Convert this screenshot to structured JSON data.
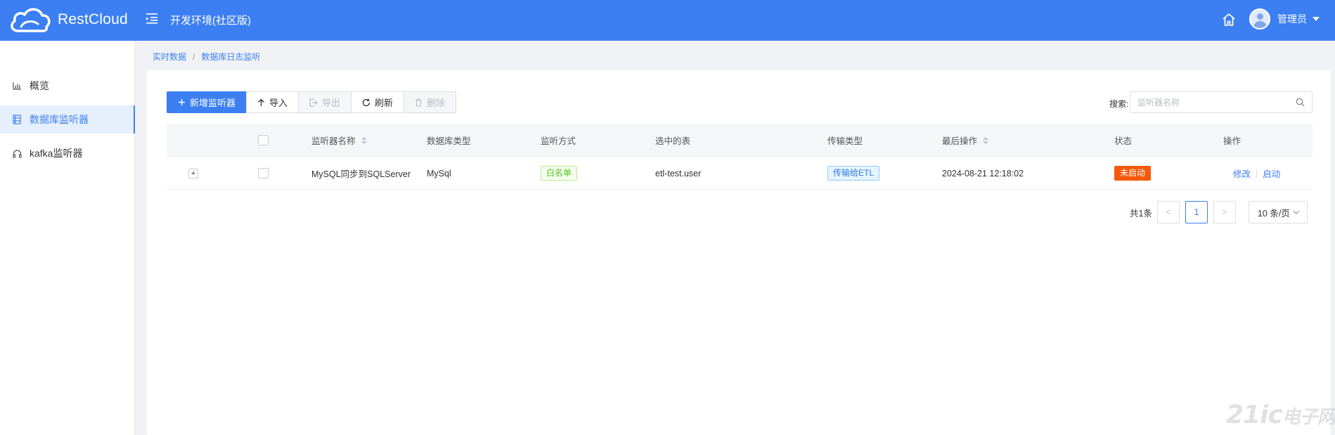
{
  "header": {
    "logo_text": "RestCloud",
    "env_title": "开发环境(社区版)",
    "user_name": "管理员"
  },
  "sidebar": {
    "items": [
      {
        "label": "概览",
        "icon": "bar-chart-icon"
      },
      {
        "label": "数据库监听器",
        "icon": "database-icon",
        "active": true
      },
      {
        "label": "kafka监听器",
        "icon": "headphones-icon"
      }
    ]
  },
  "breadcrumb": {
    "items": [
      "实时数据",
      "数据库日志监听"
    ],
    "separator": "/"
  },
  "toolbar": {
    "add_label": "新增监听器",
    "import_label": "导入",
    "export_label": "导出",
    "refresh_label": "刷新",
    "delete_label": "删除"
  },
  "search": {
    "label": "搜索:",
    "placeholder": "监听器名称",
    "value": ""
  },
  "table": {
    "columns": [
      "监听器名称",
      "数据库类型",
      "监听方式",
      "选中的表",
      "传输类型",
      "最后操作",
      "状态",
      "操作"
    ],
    "rows": [
      {
        "expand": "+",
        "name": "MySQL同步到SQLServer",
        "db_type": "MySql",
        "listen_mode": "白名单",
        "tables": "etl-test.user",
        "transfer_type": "传输给ETL",
        "last_op": "2024-08-21 12:18:02",
        "status": "未启动",
        "op_edit": "修改",
        "op_start": "启动"
      }
    ]
  },
  "pagination": {
    "total": "共1条",
    "prev": "<",
    "current": "1",
    "next": ">",
    "page_size": "10 条/页"
  },
  "watermark": {
    "text": "21ic",
    "suffix": "电子网"
  },
  "colors": {
    "primary": "#3b7ff2",
    "tag_green": "#52c41a",
    "tag_blue": "#2d7be5",
    "tag_orange": "#f5590b"
  }
}
